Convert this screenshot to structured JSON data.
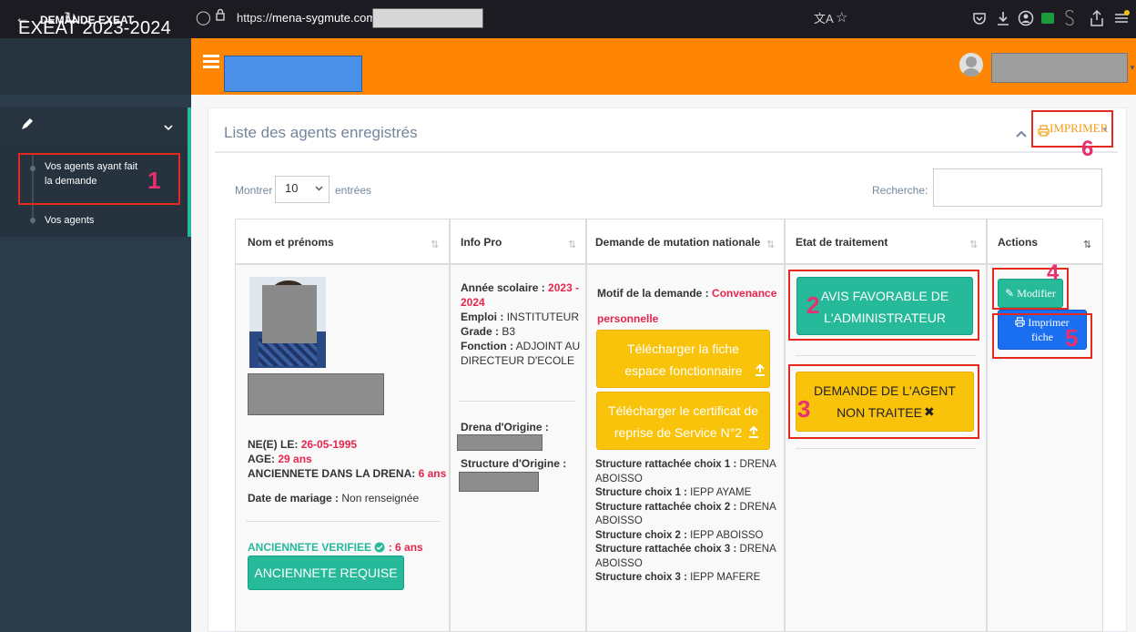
{
  "browser": {
    "back": "←",
    "forward": "→",
    "reload": "↻",
    "url_prefix": "https://",
    "url_host": "mena-sygmute.com",
    "star": "☆",
    "translate": "文A"
  },
  "sidebar": {
    "brand": "EXEAT 2023-2024",
    "menu_head": "DEMANDE EXEAT",
    "items": [
      {
        "label_line1": "Vos agents ayant fait",
        "label_line2": "la demande"
      },
      {
        "label_line1": "Vos agents"
      }
    ]
  },
  "panel": {
    "title": "Liste des agents enregistrés",
    "print_label": "IMPRIMER",
    "show_label": "Montrer",
    "entries_value": "10",
    "entries_label": "entrées",
    "search_label": "Recherche:"
  },
  "table": {
    "headers": [
      "Nom et prénoms",
      "Info Pro",
      "Demande de mutation nationale",
      "Etat de traitement",
      "Actions"
    ]
  },
  "agent": {
    "born_label": "NE(E) LE:",
    "born_value": "26-05-1995",
    "age_label": "AGE:",
    "age_value": "29 ans",
    "anc_label": "ANCIENNETE DANS LA DRENA:",
    "anc_value": "6 ans",
    "marriage_label": "Date de mariage :",
    "marriage_value": "Non renseignée",
    "anc_verif_label": "ANCIENNETE VERIFIEE",
    "anc_verif_value": ": 6 ans",
    "anc_button": "ANCIENNETE REQUISE"
  },
  "info_pro": {
    "year_label": "Année scolaire :",
    "year_value_1": "2023 -",
    "year_value_2": "2024",
    "emploi_label": "Emploi :",
    "emploi_value": "INSTITUTEUR",
    "grade_label": "Grade :",
    "grade_value": "B3",
    "fonction_label": "Fonction :",
    "fonction_value_1": "ADJOINT AU",
    "fonction_value_2": "DIRECTEUR D'ECOLE",
    "drena_label": "Drena d'Origine :",
    "structure_label": "Structure d'Origine :"
  },
  "mutation": {
    "motif_label": "Motif de la demande :",
    "motif_value_1": "Convenance",
    "motif_value_2": "personnelle",
    "btn1_line1": "Télécharger la fiche",
    "btn1_line2": "espace fonctionnaire",
    "btn2_line1": "Télécharger le certificat de",
    "btn2_line2": "reprise de Service N°2",
    "choices": [
      {
        "label": "Structure rattachée choix 1 :",
        "value_1": "DRENA",
        "value_2": "ABOISSO"
      },
      {
        "label": "Structure choix 1 :",
        "value_1": "IEPP AYAME"
      },
      {
        "label": "Structure rattachée choix 2 :",
        "value_1": "DRENA",
        "value_2": "ABOISSO"
      },
      {
        "label": "Structure choix 2 :",
        "value_1": "IEPP ABOISSO"
      },
      {
        "label": "Structure rattachée choix 3 :",
        "value_1": "DRENA",
        "value_2": "ABOISSO"
      },
      {
        "label": "Structure choix 3 :",
        "value_1": "IEPP MAFERE"
      }
    ]
  },
  "etat": {
    "avis_line1": "AVIS FAVORABLE DE",
    "avis_line2": "L'ADMINISTRATEUR",
    "demande_line1": "DEMANDE DE L'AGENT",
    "demande_line2": "NON TRAITEE"
  },
  "actions": {
    "modifier": "Modifier",
    "imprimer_line1": "Imprimer",
    "imprimer_line2": "fiche"
  },
  "markers": [
    "1",
    "2",
    "3",
    "4",
    "5",
    "6"
  ],
  "colors": {
    "topbar": "#fe8603",
    "sidebar": "#2c3b4a",
    "green": "#26b99a",
    "yellow": "#f9c30c",
    "blue": "#1a6ff0",
    "annotation_red": "#e42a1e",
    "marker_pink": "#ea2f6f"
  }
}
